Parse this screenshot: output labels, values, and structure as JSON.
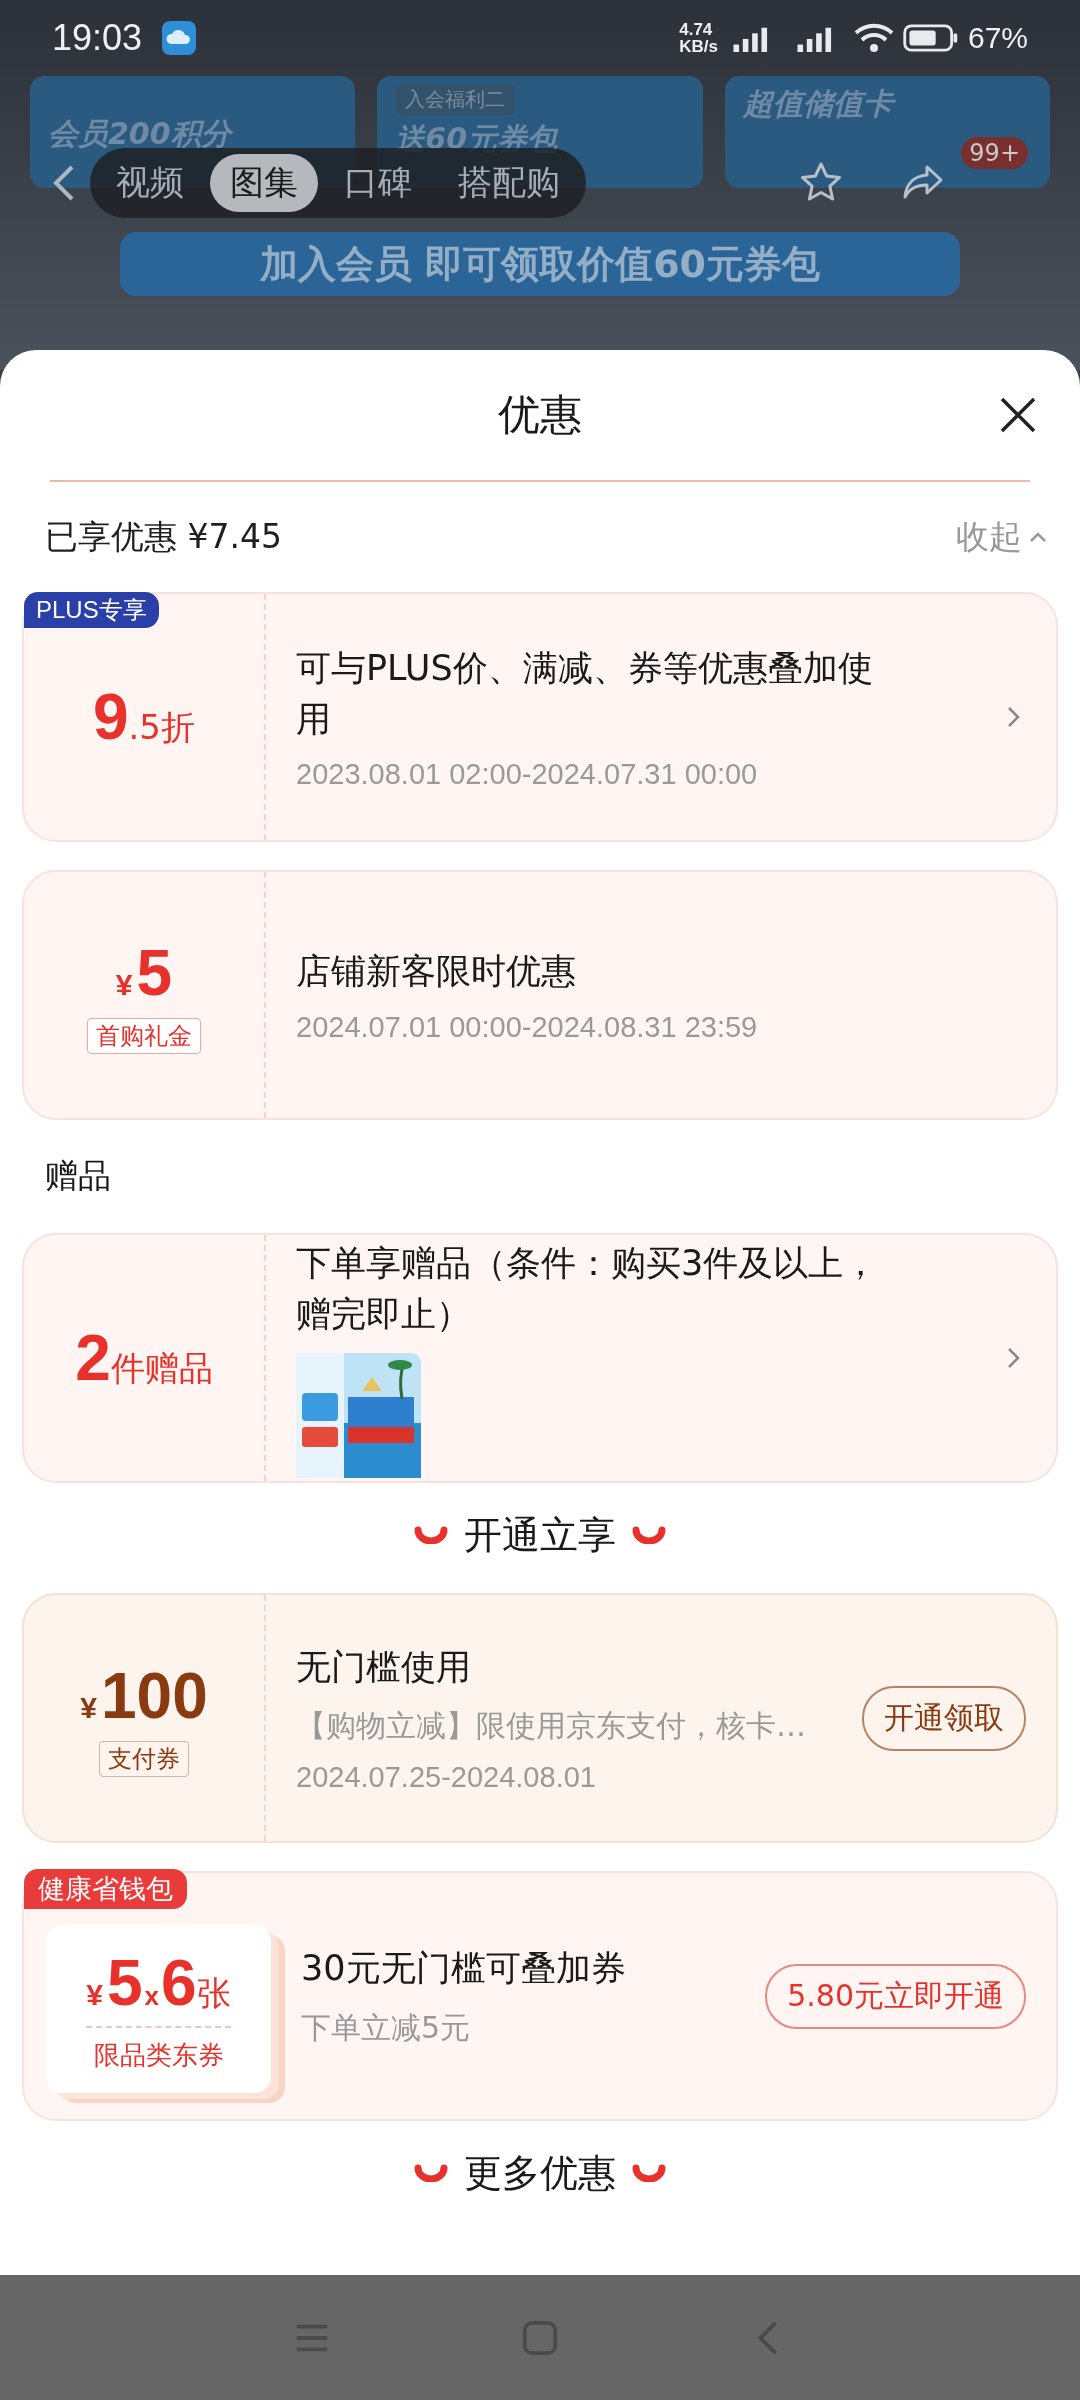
{
  "status_bar": {
    "time": "19:03",
    "net_speed": "4.74",
    "net_unit": "KB/s",
    "battery": "67%"
  },
  "backdrop": {
    "banners": [
      {
        "title": "会员200积分"
      },
      {
        "tag": "入会福利二",
        "title": "送60元券包"
      },
      {
        "title": "超值储值卡"
      }
    ],
    "tabs": [
      {
        "label": "视频",
        "selected": false
      },
      {
        "label": "图集",
        "selected": true
      },
      {
        "label": "口碑",
        "selected": false
      },
      {
        "label": "搭配购",
        "selected": false
      }
    ],
    "cart_badge": "99+",
    "join_banner": "加入会员 即可领取价值60元券包"
  },
  "sheet": {
    "title": "优惠",
    "saved": "已享优惠 ¥7.45",
    "collapse": "收起",
    "blocks": [
      {
        "kind": "coupon",
        "badge": "PLUS专享",
        "big": "9",
        "small": ".5折",
        "title": "可与PLUS价、满减、券等优惠叠加使用",
        "date": "2023.08.01 02:00-2024.07.31 00:00",
        "chevron": true
      },
      {
        "kind": "coupon",
        "currency": "¥",
        "big": "5",
        "tag": "首购礼金",
        "title": "店铺新客限时优惠",
        "date": "2024.07.01 00:00-2024.08.31 23:59",
        "chevron": false
      },
      {
        "kind": "label",
        "text": "赠品"
      },
      {
        "kind": "coupon",
        "big": "2",
        "small": "件赠品",
        "title": "下单享赠品（条件：购买3件及以上，赠完即止）",
        "picture": true,
        "chevron": true
      },
      {
        "kind": "heading",
        "text": "开通立享"
      },
      {
        "kind": "pay_coupon",
        "currency": "¥",
        "big": "100",
        "tag": "支付券",
        "title": "无门槛使用",
        "desc": "【购物立减】限使用京东支付，核卡…",
        "date": "2024.07.25-2024.08.01",
        "button": "开通领取",
        "chevron": false
      },
      {
        "kind": "wallet",
        "badge": "健康省钱包",
        "currency": "¥",
        "big": "5",
        "times": "x",
        "count": "6",
        "unit": "张",
        "tag": "限品类东券",
        "title": "30元无门槛可叠加券",
        "desc": "下单立减5元",
        "button": "5.80元立即开通"
      },
      {
        "kind": "heading",
        "text": "更多优惠"
      }
    ]
  }
}
